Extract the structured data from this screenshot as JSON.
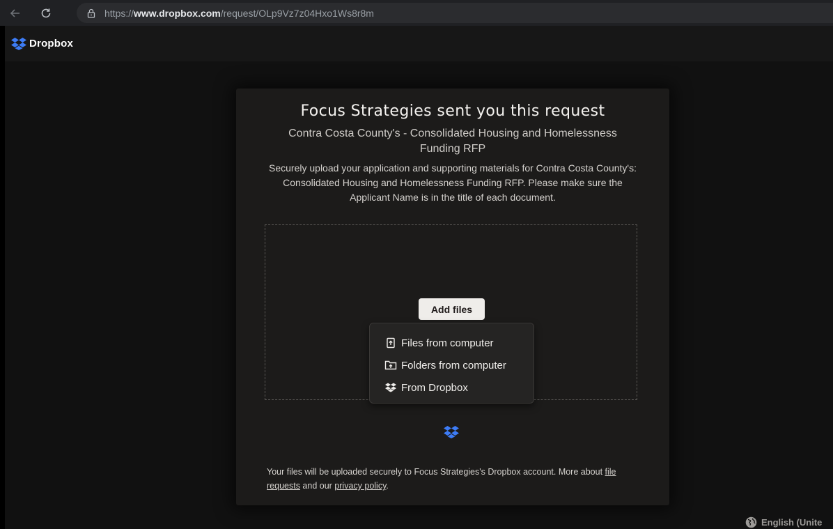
{
  "browser": {
    "url_scheme": "https://",
    "url_domain": "www.dropbox.com",
    "url_path": "/request/OLp9Vz7z04Hxo1Ws8r8m"
  },
  "header": {
    "brand": "Dropbox"
  },
  "request": {
    "title": "Focus Strategies sent you this request",
    "subtitle": "Contra Costa County's - Consolidated Housing and Homelessness Funding RFP",
    "description": "Securely upload your application and supporting materials for Contra Costa County's: Consolidated Housing and Homelessness Funding RFP. Please make sure the Applicant Name is in the title of each document."
  },
  "upload": {
    "add_files_label": "Add files",
    "menu": [
      {
        "label": "Files from computer",
        "icon": "file-upload-icon"
      },
      {
        "label": "Folders from computer",
        "icon": "folder-upload-icon"
      },
      {
        "label": "From Dropbox",
        "icon": "dropbox-icon"
      }
    ]
  },
  "footer": {
    "text_before": "Your files will be uploaded securely to Focus Strategies's Dropbox account. More about ",
    "link_file_requests": "file requests",
    "text_middle": " and our ",
    "link_privacy": "privacy policy",
    "text_after": "."
  },
  "language": {
    "label": "English (Unite"
  },
  "colors": {
    "dropbox_blue": "#3d7cf5",
    "background": "#111111",
    "card": "#1c1b1a"
  }
}
